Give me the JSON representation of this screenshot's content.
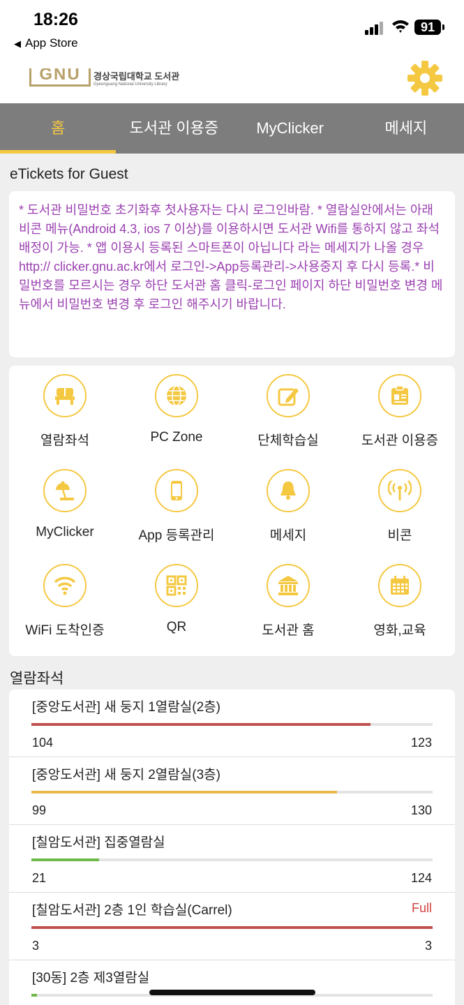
{
  "status": {
    "time": "18:26",
    "back_label": "App Store",
    "battery": "91"
  },
  "header": {
    "logo_mark": "GNU",
    "logo_ko": "경상국립대학교 도서관",
    "logo_en": "Gyeongsang National University Library"
  },
  "tabs": [
    {
      "label": "홈",
      "active": true
    },
    {
      "label": "도서관 이용증",
      "active": false
    },
    {
      "label": "MyClicker",
      "active": false
    },
    {
      "label": "메세지",
      "active": false
    }
  ],
  "section1_title": "eTickets for Guest",
  "notice": "* 도서관 비밀번호 초기화후 첫사용자는 다시 로그인바람. * 열람실안에서는 아래 비콘 메뉴(Android 4.3, ios 7 이상)를 이용하시면 도서관 Wifi를 통하지 않고 좌석배정이 가능.  * 앱 이용시 등록된 스마트폰이 아닙니다 라는 메세지가 나올 경우 http:// clicker.gnu.ac.kr에서 로그인->App등록관리->사용중지 후 다시 등록.* 비밀번호를 모르시는 경우 하단 도서관 홈 클릭-로그인 페이지 하단 비밀번호 변경 메뉴에서 비밀번호 변경 후 로그인 해주시기 바랍니다.",
  "menu": [
    {
      "label": "열람좌석",
      "icon": "seat-icon"
    },
    {
      "label": "PC Zone",
      "icon": "globe-icon"
    },
    {
      "label": "단체학습실",
      "icon": "edit-icon"
    },
    {
      "label": "도서관 이용증",
      "icon": "id-card-icon"
    },
    {
      "label": "MyClicker",
      "icon": "desk-lamp-icon"
    },
    {
      "label": "App 등록관리",
      "icon": "phone-icon"
    },
    {
      "label": "메세지",
      "icon": "bell-icon"
    },
    {
      "label": "비콘",
      "icon": "beacon-icon"
    },
    {
      "label": "WiFi 도착인증",
      "icon": "wifi-icon"
    },
    {
      "label": "QR",
      "icon": "qr-icon"
    },
    {
      "label": "도서관 홈",
      "icon": "library-building-icon"
    },
    {
      "label": "영화,교육",
      "icon": "calendar-icon"
    }
  ],
  "section2_title": "열람좌석",
  "rooms": [
    {
      "name": "[중앙도서관] 새 둥지 1열람실(2층)",
      "used": "104",
      "total": "123",
      "full": "",
      "color": "#c0504d"
    },
    {
      "name": "[중앙도서관] 새 둥지 2열람실(3층)",
      "used": "99",
      "total": "130",
      "full": "",
      "color": "#e6b94a"
    },
    {
      "name": "[칠암도서관] 집중열람실",
      "used": "21",
      "total": "124",
      "full": "",
      "color": "#6fb84a"
    },
    {
      "name": "[칠암도서관] 2층 1인 학습실(Carrel)",
      "used": "3",
      "total": "3",
      "full": "Full",
      "color": "#c0504d"
    },
    {
      "name": "[30동] 2층 제3열람실",
      "used": "",
      "total": "",
      "full": "",
      "color": "#6fb84a",
      "ratio": 0.014
    }
  ]
}
